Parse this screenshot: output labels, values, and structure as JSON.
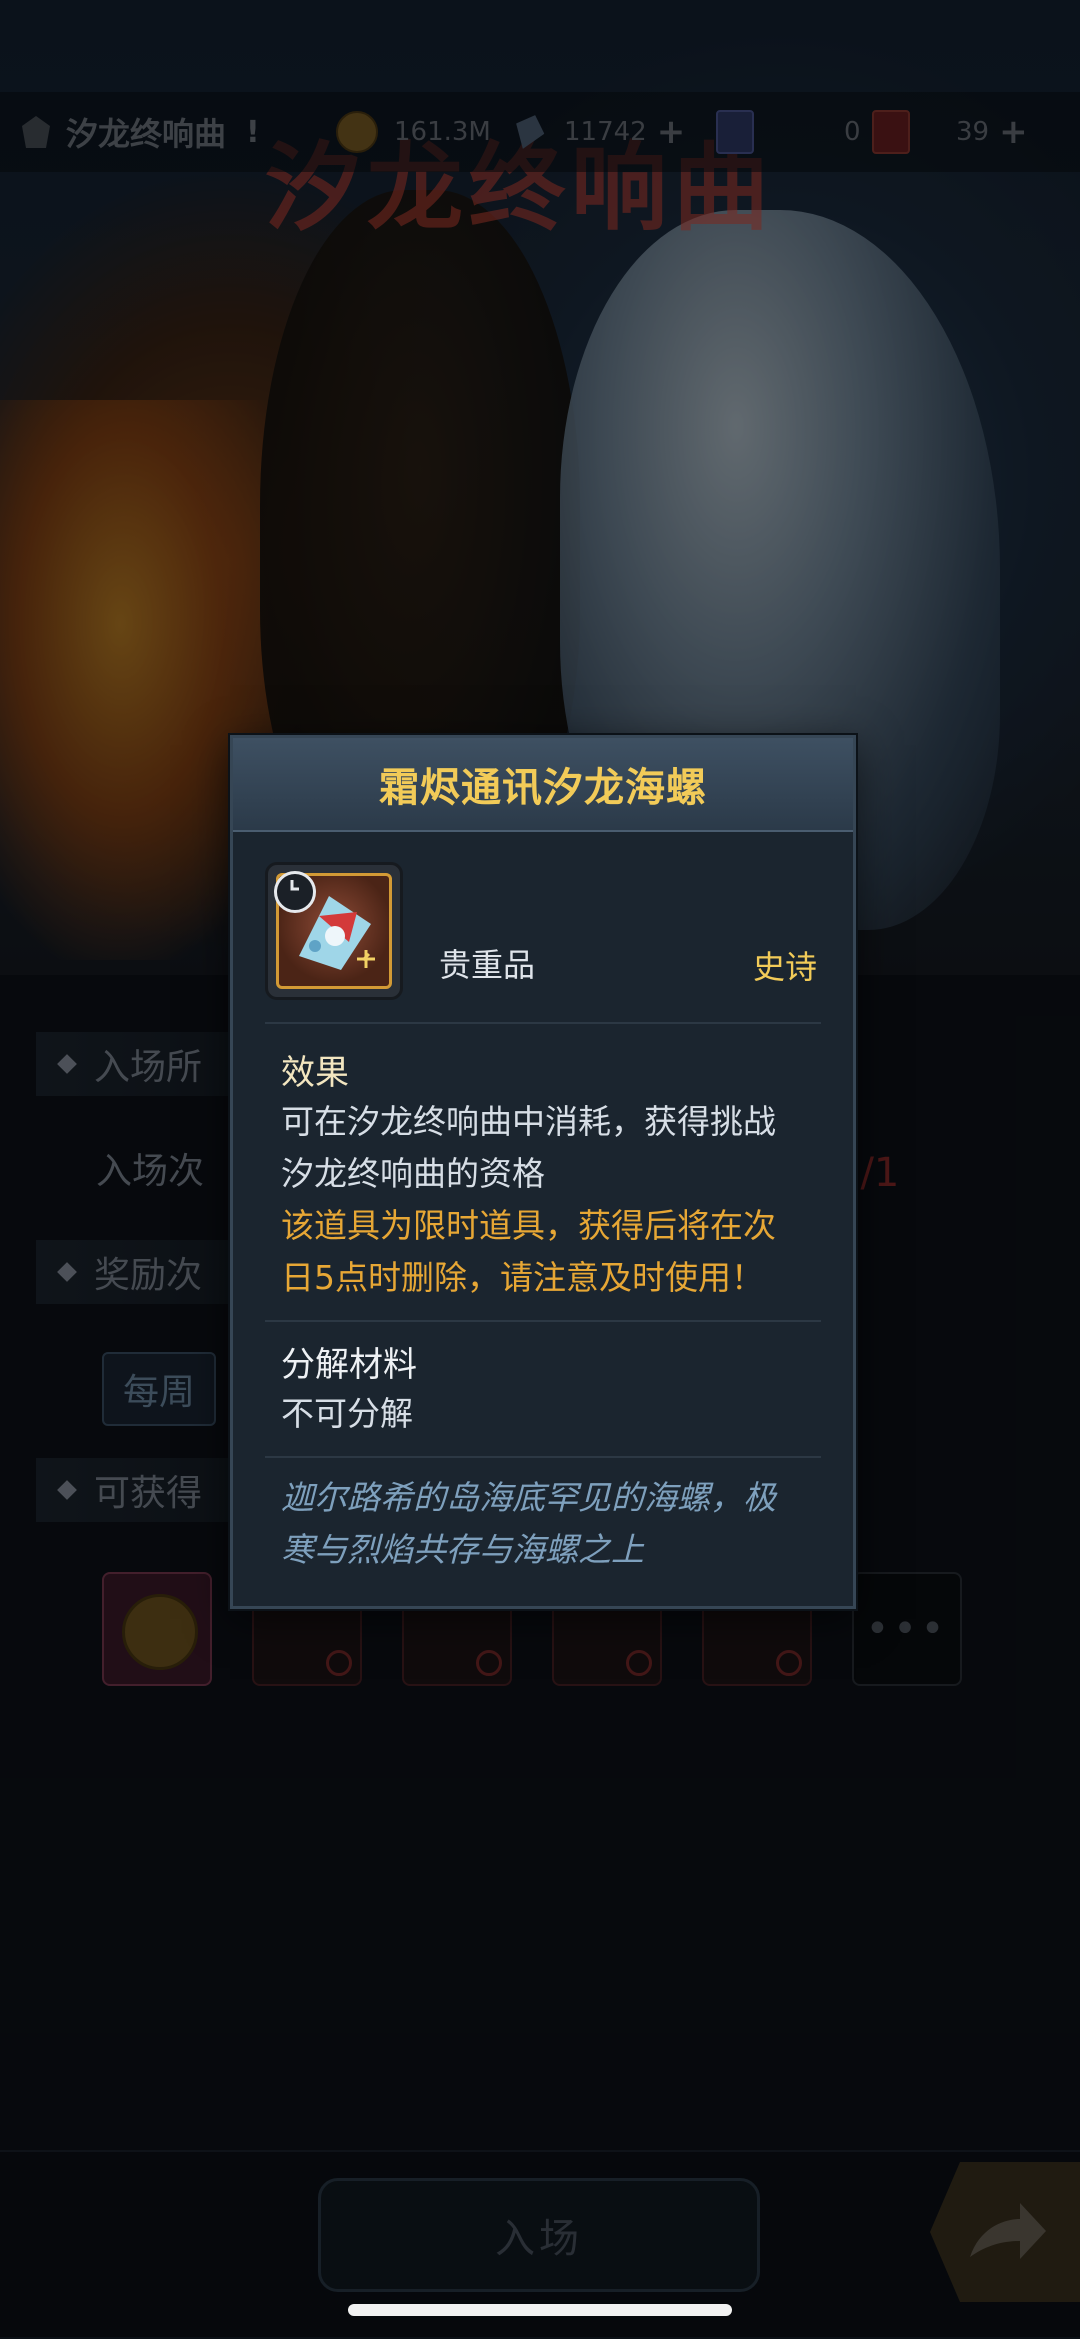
{
  "header": {
    "title": "汐龙终响曲",
    "help": "!",
    "resources": [
      {
        "name": "gold",
        "icon": "coin-icon",
        "value": "161.3M"
      },
      {
        "name": "crystal",
        "icon": "crystal-icon",
        "value": "11742",
        "plus": "+"
      },
      {
        "name": "ticket",
        "icon": "ticket-icon",
        "value": "0"
      },
      {
        "name": "card",
        "icon": "card-icon",
        "value": "39",
        "plus": "+"
      }
    ]
  },
  "banner": {
    "title": "汐龙终响曲"
  },
  "page": {
    "sections": [
      "入场所",
      "奖励次",
      "可获得"
    ],
    "entry_label": "入场次",
    "entry_count": "0/1",
    "tab_weekly": "每周",
    "more": "•••"
  },
  "footer": {
    "enter_label": "入场"
  },
  "modal": {
    "title": "霜烬通讯汐龙海螺",
    "item_type": "贵重品",
    "rarity": "史诗",
    "effect_title": "效果",
    "effect_lines": [
      "可在汐龙终响曲中消耗，获得挑战",
      "汐龙终响曲的资格"
    ],
    "warning_lines": [
      "该道具为限时道具，获得后将在次",
      "日5点时删除，请注意及时使用！"
    ],
    "decompose_title": "分解材料",
    "decompose_value": "不可分解",
    "flavor_lines": [
      "迦尔路希的岛海底罕见的海螺，极",
      "寒与烈焰共存与海螺之上"
    ]
  },
  "colors": {
    "accent_gold": "#f2cb58",
    "warning_orange": "#e7a735",
    "flavor_blue": "#7ea0bd",
    "modal_bg": "#1b252f"
  }
}
